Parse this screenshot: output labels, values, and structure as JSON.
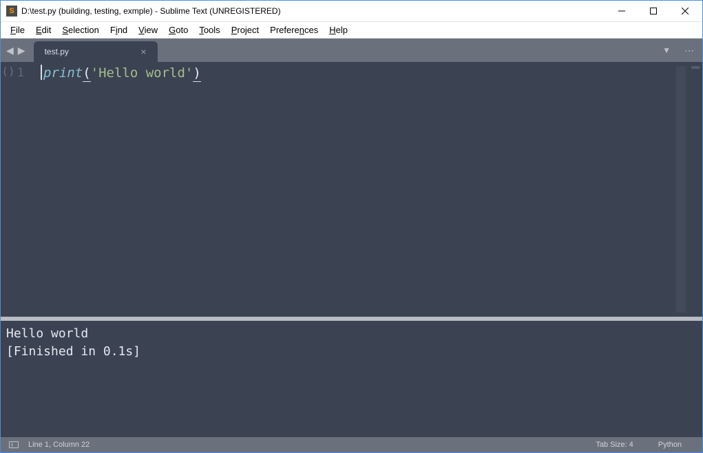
{
  "window": {
    "title": "D:\\test.py (building, testing, exmple) - Sublime Text (UNREGISTERED)"
  },
  "menu": {
    "file": "File",
    "edit": "Edit",
    "selection": "Selection",
    "find": "Find",
    "view": "View",
    "goto": "Goto",
    "tools": "Tools",
    "project": "Project",
    "preferences": "Preferences",
    "help": "Help"
  },
  "tab": {
    "name": "test.py"
  },
  "editor": {
    "line_number": "1",
    "fold_hint": "()",
    "tokens": {
      "func": "print ",
      "open_paren": "(",
      "string": "'Hello world'",
      "close_paren": ")"
    }
  },
  "output": {
    "line1": "Hello world",
    "line2": "[Finished in 0.1s]"
  },
  "status": {
    "position": "Line 1, Column 22",
    "tab_size": "Tab Size: 4",
    "syntax": "Python"
  }
}
